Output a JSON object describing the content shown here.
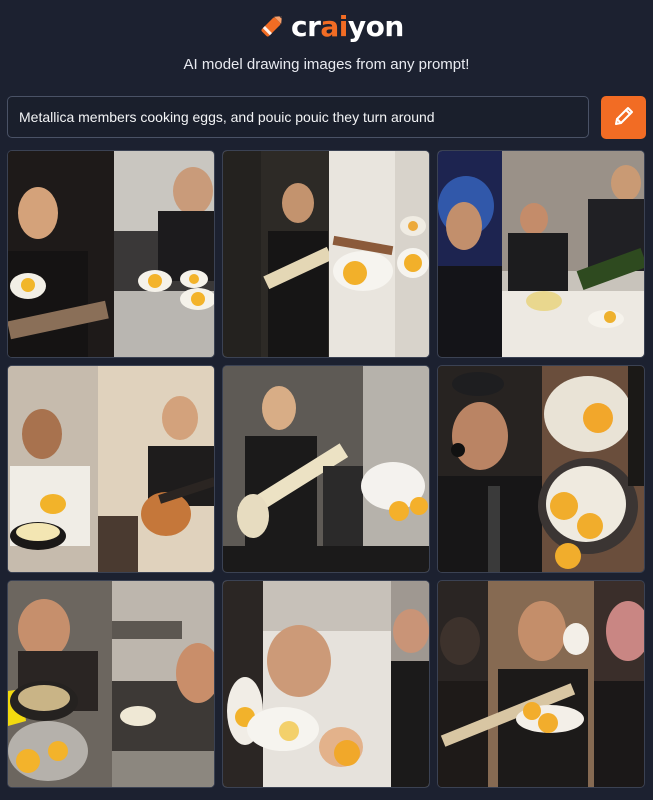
{
  "app": {
    "logo_prefix": "cr",
    "logo_accent": "ai",
    "logo_suffix": "yon",
    "accent_color": "#f26c24",
    "tagline": "AI model drawing images from any prompt!"
  },
  "prompt": {
    "value": "Metallica members cooking eggs, and pouic pouic they turn around",
    "button_icon": "pencil-icon"
  },
  "results": {
    "images": [
      {
        "description_icon": "generated-image"
      },
      {
        "description_icon": "generated-image"
      },
      {
        "description_icon": "generated-image"
      },
      {
        "description_icon": "generated-image"
      },
      {
        "description_icon": "generated-image"
      },
      {
        "description_icon": "generated-image"
      },
      {
        "description_icon": "generated-image"
      },
      {
        "description_icon": "generated-image"
      },
      {
        "description_icon": "generated-image"
      }
    ]
  }
}
